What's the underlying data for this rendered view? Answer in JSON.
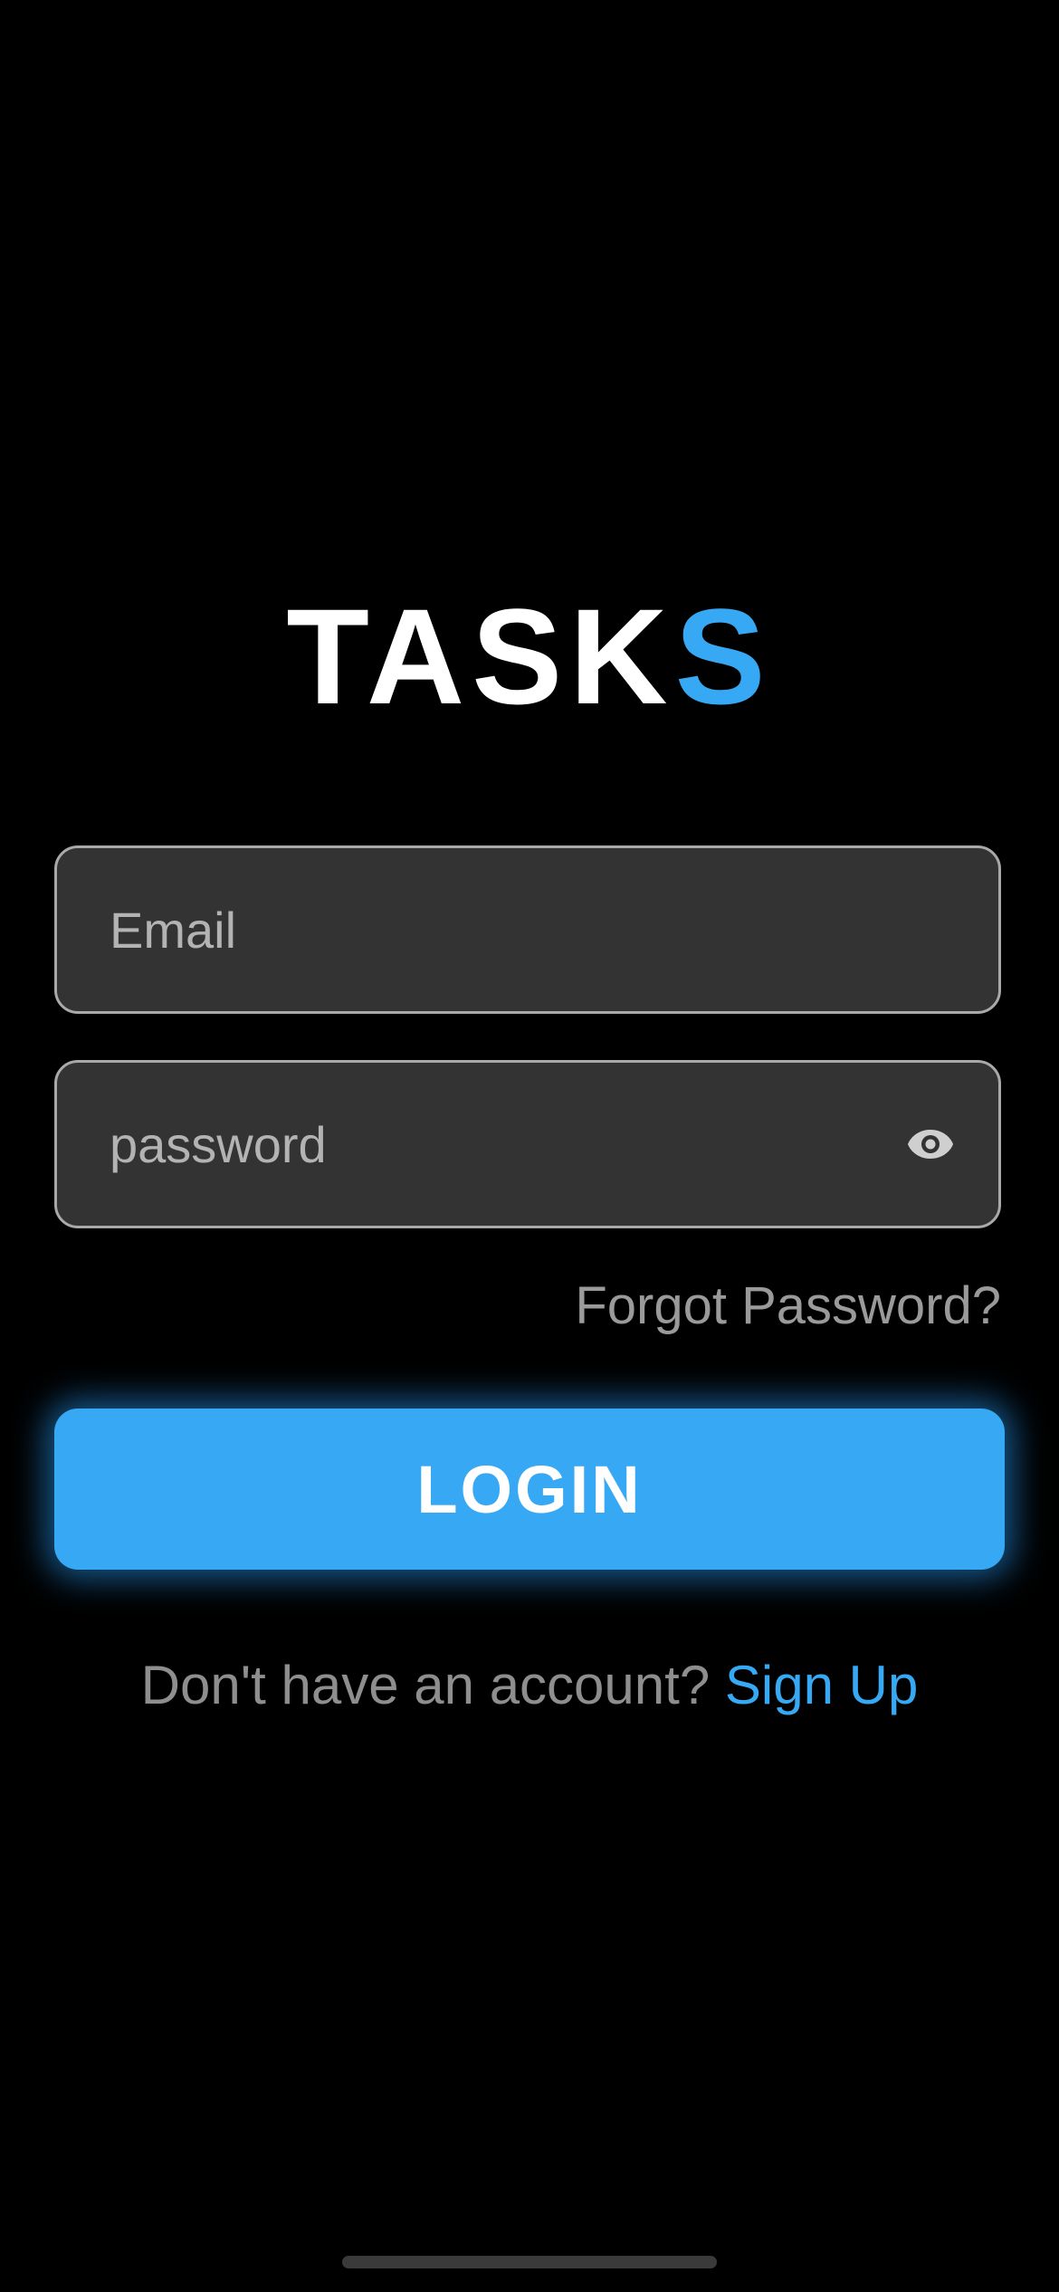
{
  "logo": {
    "main": "TASK",
    "accent": "S"
  },
  "form": {
    "email_placeholder": "Email",
    "password_placeholder": "password",
    "toggle_icon": "eye-icon",
    "forgot_label": "Forgot Password?",
    "login_label": "LOGIN"
  },
  "signup": {
    "prompt": "Don't have an account?",
    "link_label": "Sign Up"
  },
  "colors": {
    "background": "#000000",
    "accent": "#37a9f4",
    "field_background": "#333333",
    "field_border": "#a9a9a9",
    "muted_text": "#9a9a9a"
  }
}
